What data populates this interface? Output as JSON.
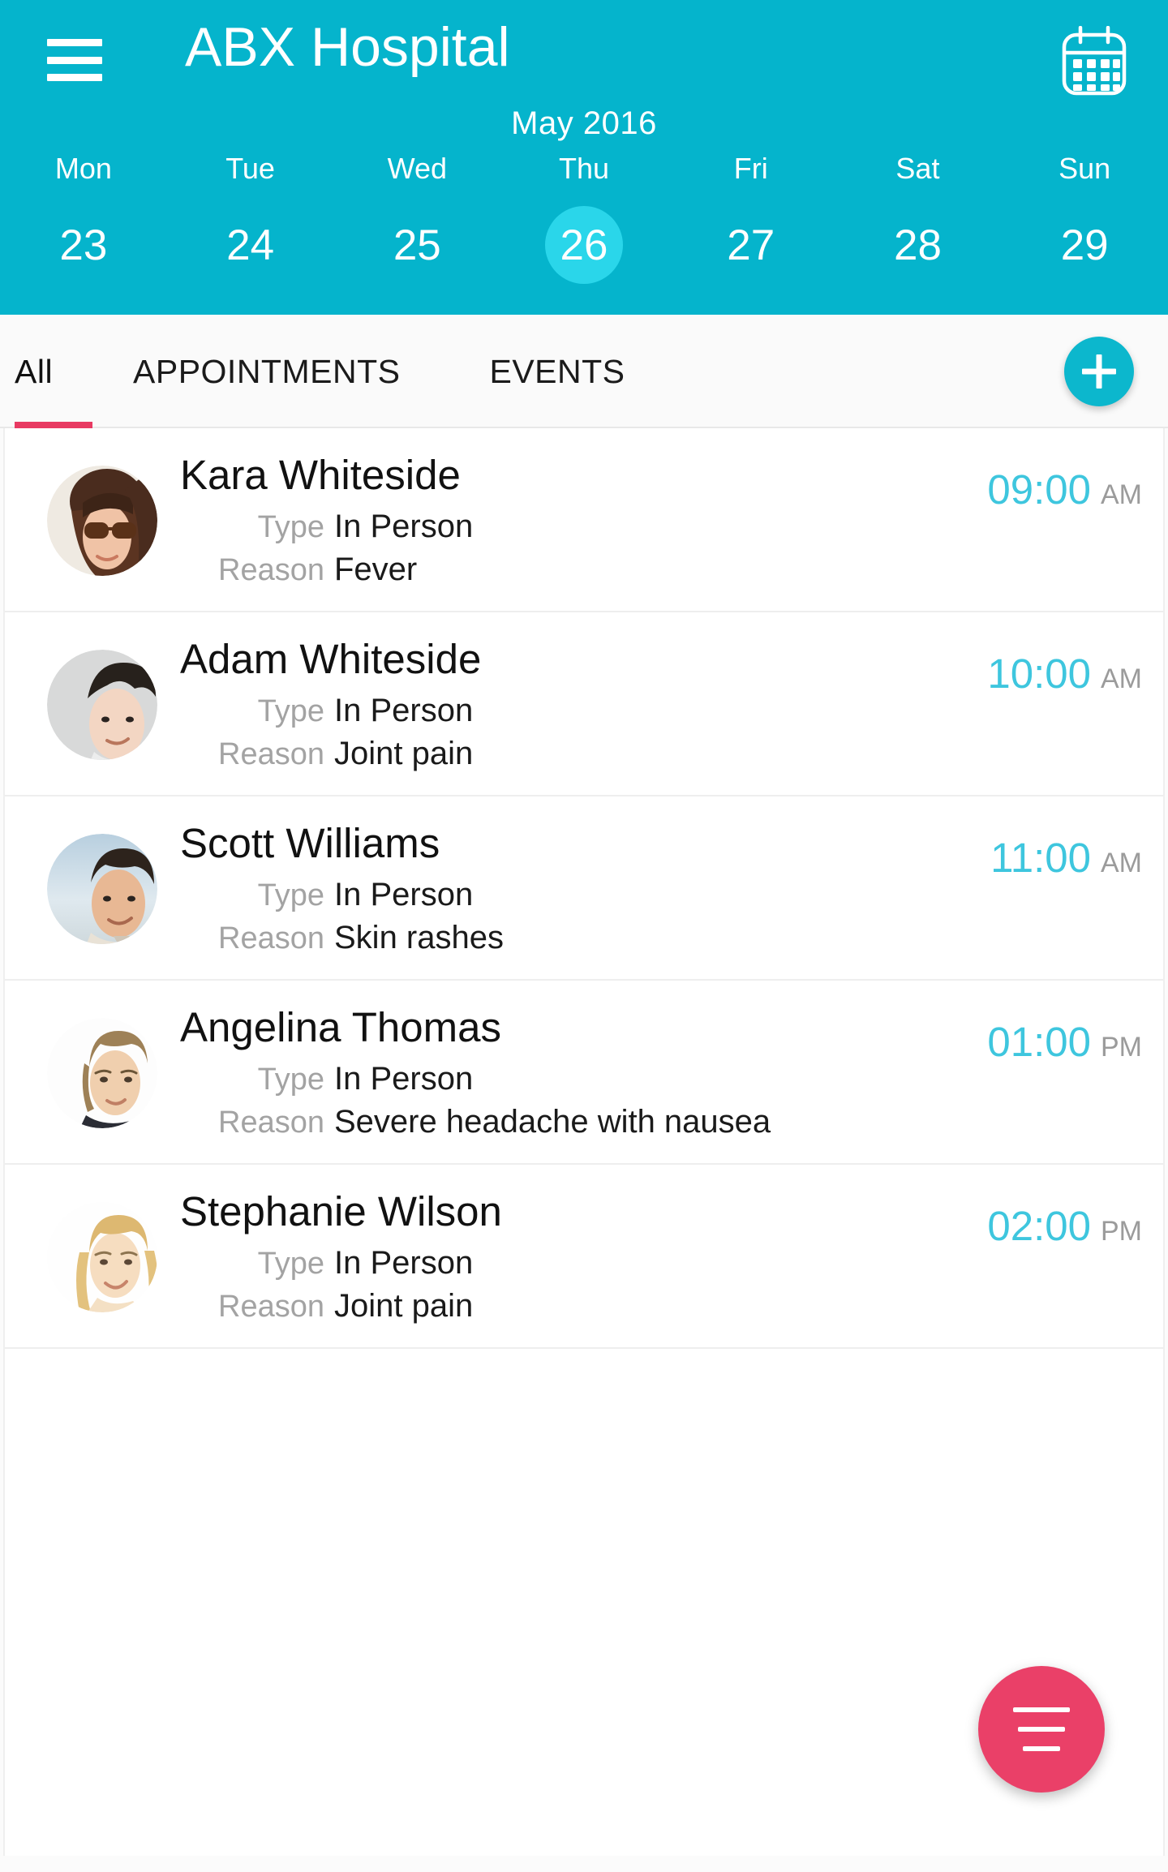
{
  "header": {
    "menu_icon": "hamburger-menu-icon",
    "title": "ABX Hospital",
    "calendar_icon": "calendar-icon",
    "month": "May 2016",
    "accent_color": "#05b4cc",
    "selected_highlight_color": "#2ad6ea",
    "week": [
      {
        "name": "Mon",
        "num": "23",
        "selected": false
      },
      {
        "name": "Tue",
        "num": "24",
        "selected": false
      },
      {
        "name": "Wed",
        "num": "25",
        "selected": false
      },
      {
        "name": "Thu",
        "num": "26",
        "selected": true
      },
      {
        "name": "Fri",
        "num": "27",
        "selected": false
      },
      {
        "name": "Sat",
        "num": "28",
        "selected": false
      },
      {
        "name": "Sun",
        "num": "29",
        "selected": false
      }
    ]
  },
  "tabbar": {
    "tabs": [
      {
        "label": "All",
        "active": true
      },
      {
        "label": "APPOINTMENTS",
        "active": false
      },
      {
        "label": "EVENTS",
        "active": false
      }
    ],
    "active_underline_color": "#e83a62",
    "add_button": {
      "icon": "plus-icon",
      "color": "#0cb7cd"
    }
  },
  "list": {
    "labels": {
      "type": "Type",
      "reason": "Reason"
    },
    "appointments": [
      {
        "avatar": "avatar-woman-sunglasses",
        "name": "Kara Whiteside",
        "type": "In Person",
        "reason": "Fever",
        "time": "09:00",
        "meridiem": "AM"
      },
      {
        "avatar": "avatar-man-curly-hair",
        "name": "Adam Whiteside",
        "type": "In Person",
        "reason": "Joint pain",
        "time": "10:00",
        "meridiem": "AM"
      },
      {
        "avatar": "avatar-man-blue-background",
        "name": "Scott Williams",
        "type": "In Person",
        "reason": "Skin rashes",
        "time": "11:00",
        "meridiem": "AM"
      },
      {
        "avatar": "avatar-woman-short-hair",
        "name": "Angelina Thomas",
        "type": "In Person",
        "reason": "Severe headache with nausea",
        "time": "01:00",
        "meridiem": "PM"
      },
      {
        "avatar": "avatar-woman-blonde",
        "name": "Stephanie Wilson",
        "type": "In Person",
        "reason": "Joint pain",
        "time": "02:00",
        "meridiem": "PM"
      }
    ]
  },
  "filter_button": {
    "icon": "filter-lines-icon",
    "color": "#ea4068"
  }
}
